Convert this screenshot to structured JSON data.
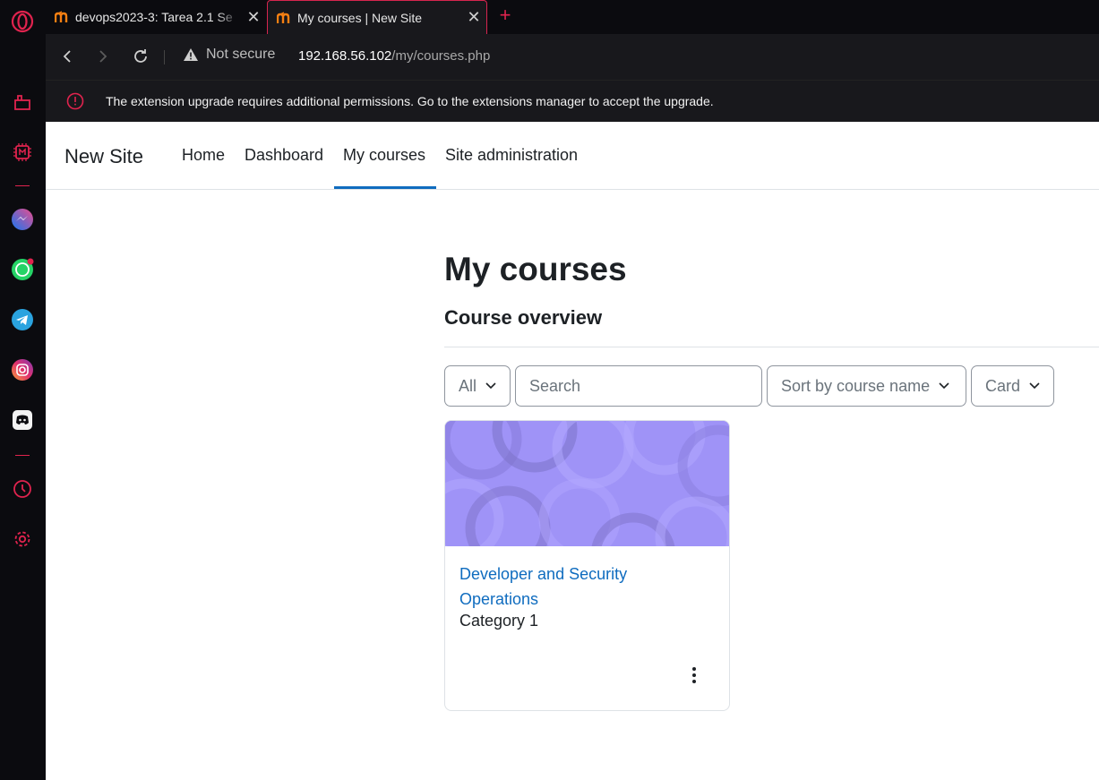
{
  "browser": {
    "tabs": [
      {
        "title": "devops2023-3: Tarea 2.1 Se",
        "active": false,
        "favicon": "moodle-icon"
      },
      {
        "title": "My courses | New Site",
        "active": true,
        "favicon": "moodle-icon"
      }
    ],
    "security_label": "Not secure",
    "url_host": "192.168.56.102",
    "url_path": "/my/courses.php",
    "infobar_message": "The extension upgrade requires additional permissions. Go to the extensions manager to accept the upgrade.",
    "accent_color": "#e0234e"
  },
  "sidebar": {
    "icons": [
      "opera-logo-icon",
      "workspace-icon",
      "aria-ai-icon",
      "messenger-icon",
      "whatsapp-icon",
      "telegram-icon",
      "instagram-icon",
      "discord-icon",
      "history-icon",
      "settings-icon"
    ]
  },
  "site": {
    "brand": "New Site",
    "nav": [
      {
        "label": "Home",
        "active": false
      },
      {
        "label": "Dashboard",
        "active": false
      },
      {
        "label": "My courses",
        "active": true
      },
      {
        "label": "Site administration",
        "active": false
      }
    ]
  },
  "main": {
    "title": "My courses",
    "section_title": "Course overview",
    "filters": {
      "grouping": "All",
      "search_placeholder": "Search",
      "sort": "Sort by course name",
      "view": "Card"
    },
    "courses": [
      {
        "name": "Developer and Security Operations",
        "category": "Category 1"
      }
    ]
  },
  "colors": {
    "link": "#0f6cbf",
    "text": "#1d2125",
    "course_image": "#9f93f7"
  }
}
